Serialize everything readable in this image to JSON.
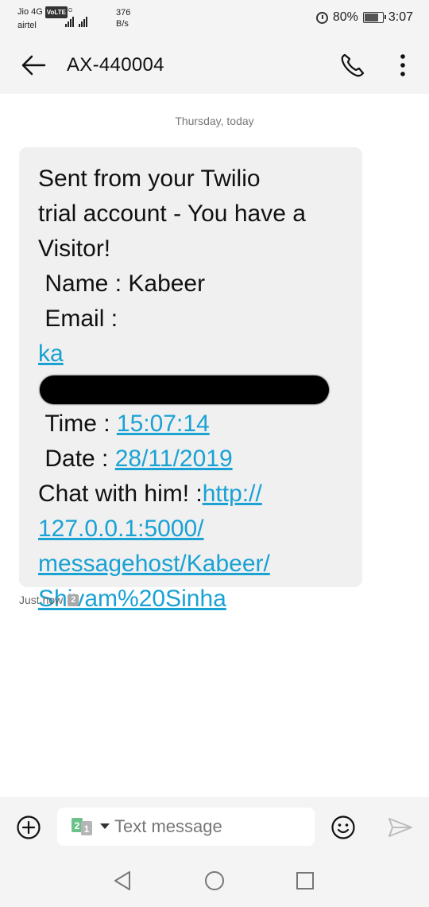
{
  "status_bar": {
    "carrier1": "Jio 4G",
    "volte": "VoLTE",
    "carrier2": "airtel",
    "net_label": "4G",
    "speed_value": "376",
    "speed_unit": "B/s",
    "battery": "80%",
    "time": "3:07"
  },
  "header": {
    "title": "AX-440004",
    "icons": [
      "back-arrow-icon",
      "phone-icon",
      "more-vert-icon"
    ]
  },
  "conversation": {
    "date_separator": "Thursday, today",
    "message": {
      "line1": "Sent from your Twilio",
      "line2": "trial account - You have a",
      "line3": "Visitor!",
      "name_line": " Name : Kabeer",
      "email_label": " Email :",
      "email_visible": "ka",
      "time_label": " Time : ",
      "time_value": "15:07:14",
      "date_label": " Date : ",
      "date_value": "28/11/2019",
      "chat_label": "Chat with him! :",
      "url_part1": "http://",
      "url_part2": "127.0.0.1:5000/",
      "url_part3": "messagehost/Kabeer/",
      "url_part4": "Shivam%20Sinha"
    },
    "status": "Just now",
    "sim_badge": "2"
  },
  "composer": {
    "placeholder": "Text message",
    "sim_selector": "2 1"
  },
  "colors": {
    "link": "#1aa2d4",
    "bubble": "#f0f0f0",
    "chrome": "#f4f4f4",
    "sim_green": "#6cc38a"
  }
}
